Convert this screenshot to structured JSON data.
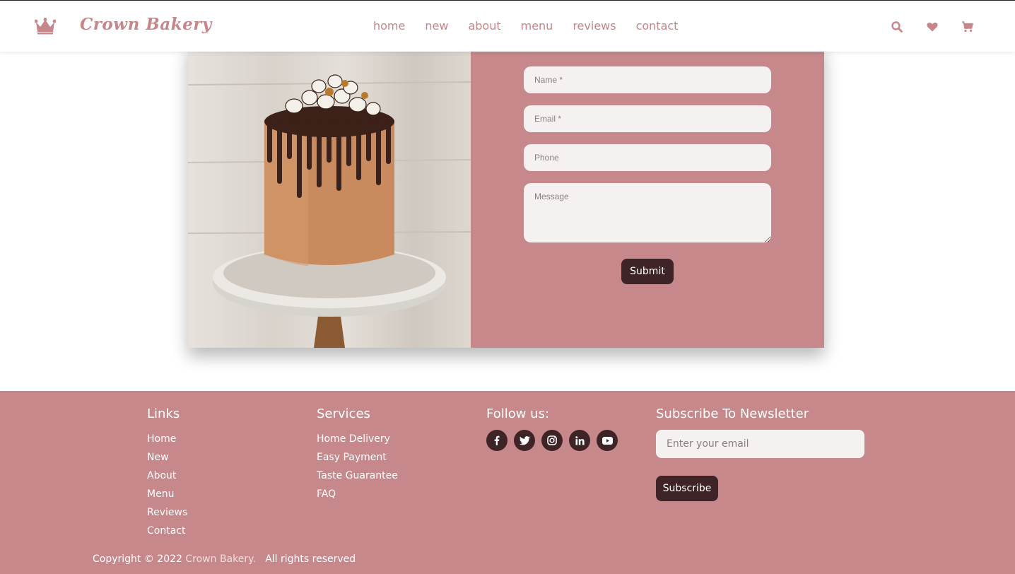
{
  "header": {
    "logo_text": "Crown Bakery",
    "nav": [
      "home",
      "new",
      "about",
      "menu",
      "reviews",
      "contact"
    ],
    "icons": [
      "search-icon",
      "heart-icon",
      "cart-icon"
    ]
  },
  "contact_form": {
    "name_placeholder": "Name *",
    "email_placeholder": "Email *",
    "phone_placeholder": "Phone",
    "message_placeholder": "Message",
    "submit_label": "Submit"
  },
  "footer": {
    "links": {
      "title": "Links",
      "items": [
        "Home",
        "New",
        "About",
        "Menu",
        "Reviews",
        "Contact"
      ]
    },
    "services": {
      "title": "Services",
      "items": [
        "Home Delivery",
        "Easy Payment",
        "Taste Guarantee",
        "FAQ"
      ]
    },
    "follow": {
      "title": "Follow us:",
      "icons": [
        "facebook-icon",
        "twitter-icon",
        "instagram-icon",
        "linkedin-icon",
        "youtube-icon"
      ]
    },
    "newsletter": {
      "title": "Subscribe To Newsletter",
      "placeholder": "Enter your email",
      "button": "Subscribe"
    },
    "copyright_prefix": "Copyright © 2022",
    "copyright_brand": "Crown Bakery.",
    "copyright_suffix": "All rights reserved"
  },
  "colors": {
    "accent": "#c6888a",
    "dark": "#3e2427"
  }
}
